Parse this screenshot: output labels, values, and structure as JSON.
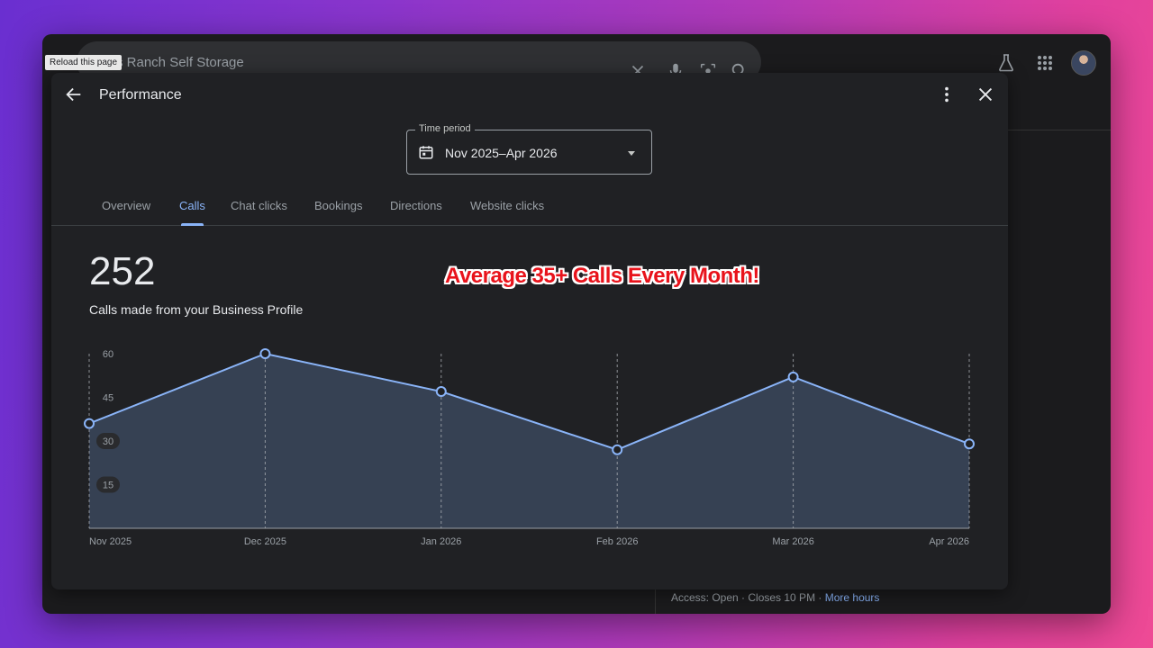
{
  "browser": {
    "search_value": "s Ranch Self Storage",
    "tooltip": "Reload this page"
  },
  "background": {
    "footer_access": "Access: Open · Closes 10 PM · ",
    "footer_more": "More hours"
  },
  "panel": {
    "title": "Performance",
    "time_period": {
      "label": "Time period",
      "value": "Nov 2025–Apr 2026"
    },
    "tabs": [
      {
        "label": "Overview",
        "active": false
      },
      {
        "label": "Calls",
        "active": true
      },
      {
        "label": "Chat clicks",
        "active": false
      },
      {
        "label": "Bookings",
        "active": false
      },
      {
        "label": "Directions",
        "active": false
      },
      {
        "label": "Website clicks",
        "active": false
      }
    ],
    "metric": {
      "value": "252",
      "description": "Calls made from your Business Profile"
    },
    "annotation": "Average 35+ Calls Every Month!"
  },
  "colors": {
    "accent": "#8ab4f8",
    "area_fill": "#3b475c",
    "annotation_red": "#e8131b"
  },
  "chart_data": {
    "type": "area",
    "categories": [
      "Nov 2025",
      "Dec 2025",
      "Jan 2026",
      "Feb 2026",
      "Mar 2026",
      "Apr 2026"
    ],
    "values": [
      36,
      60,
      47,
      27,
      52,
      29
    ],
    "yticks": [
      60,
      45,
      30,
      15
    ],
    "ylim": [
      0,
      60
    ],
    "grid": "vertical dashed"
  }
}
